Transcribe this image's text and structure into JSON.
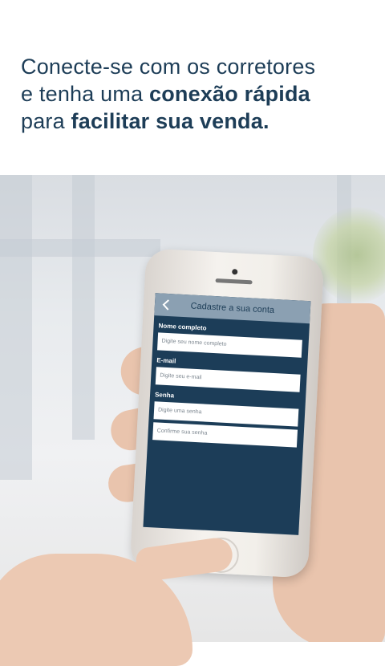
{
  "headline": {
    "line1": "Conecte-se com os corretores",
    "line2_plain": "e tenha uma ",
    "line2_bold": "conexão rápida",
    "line3_plain": "para ",
    "line3_bold": "facilitar sua venda."
  },
  "phone_screen": {
    "title": "Cadastre a sua conta",
    "fields": [
      {
        "label": "Nome completo",
        "placeholder": "Digite seu nome completo"
      },
      {
        "label": "E-mail",
        "placeholder": "Digite seu e-mail"
      },
      {
        "label": "Senha",
        "placeholder": "Digite uma senha"
      },
      {
        "label": "",
        "placeholder": "Confirme sua senha"
      }
    ]
  },
  "colors": {
    "headline": "#1d3d57",
    "screen_bg": "#1c3d58",
    "screen_header": "#8ba0b2"
  },
  "icons": {
    "back": "chevron-left-icon"
  }
}
